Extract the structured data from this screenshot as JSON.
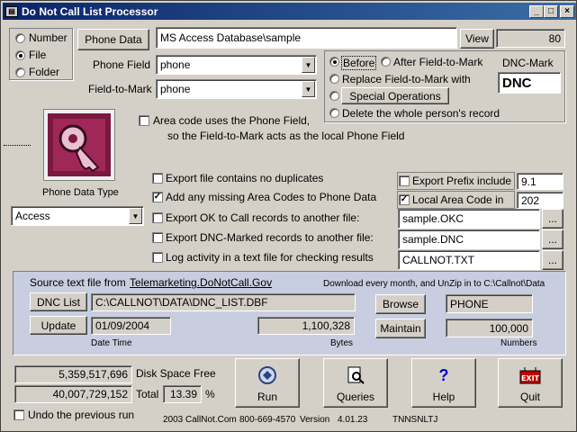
{
  "window": {
    "title": "Do Not Call List Processor",
    "min": "_",
    "max": "□",
    "close": "×"
  },
  "source_type": {
    "options": [
      "Number",
      "File",
      "Folder"
    ],
    "selected": "File"
  },
  "phone_data_button": "Phone Data",
  "phone_data_path": "MS Access Database\\sample",
  "view_button": "View",
  "count": "80",
  "phone_field": {
    "label": "Phone Field",
    "value": "phone"
  },
  "field_to_mark": {
    "label": "Field-to-Mark",
    "value": "phone"
  },
  "mark_position": {
    "before": "Before",
    "after": "After Field-to-Mark",
    "replace": "Replace Field-to-Mark with",
    "special_ops": "Special Operations",
    "delete": "Delete the whole person's record"
  },
  "dnc_mark": {
    "label": "DNC-Mark",
    "value": "DNC"
  },
  "area_code_note": {
    "line1": "Area code uses the Phone Field,",
    "line2": "so the Field-to-Mark acts as the local Phone Field"
  },
  "phone_data_type": {
    "label": "Phone Data Type",
    "value": "Access"
  },
  "options": {
    "no_duplicates": "Export file contains no duplicates",
    "add_area_codes": "Add any missing Area Codes to Phone Data",
    "export_ok": "Export OK to Call records to another file:",
    "export_dnc": "Export DNC-Marked records to another file:",
    "log_activity": "Log activity in a text file for checking results"
  },
  "export_prefix": {
    "label": "Export  Prefix include",
    "value": "9.1"
  },
  "local_area_code": {
    "label": "Local Area Code in",
    "value": "202"
  },
  "files": {
    "okc": "sample.OKC",
    "dnc": "sample.DNC",
    "log": "CALLNOT.TXT",
    "browse": "..."
  },
  "source_panel": {
    "prefix": "Source text file from",
    "site": "Telemarketing.DoNotCall.Gov",
    "download_note": "Download every month, and UnZip in to C:\\Callnot\\Data",
    "dnc_list_button": "DNC List",
    "dnc_list_path": "C:\\CALLNOT\\DATA\\DNC_LIST.DBF",
    "browse_button": "Browse",
    "field_name": "PHONE",
    "update_button": "Update",
    "date": "01/09/2004",
    "date_caption": "Date Time",
    "bytes": "1,100,328",
    "bytes_caption": "Bytes",
    "maintain_button": "Maintain",
    "numbers": "100,000",
    "numbers_caption": "Numbers"
  },
  "disk": {
    "free": "5,359,517,696",
    "free_label": "Disk Space Free",
    "total": "40,007,729,152",
    "total_label": "Total",
    "pct": "13.39",
    "pct_sign": "%"
  },
  "undo": "Undo the previous run",
  "actions": {
    "run": "Run",
    "queries": "Queries",
    "help": "Help",
    "quit": "Quit"
  },
  "footer": {
    "copyright": "2003 CallNot.Com",
    "phone": "800-669-4570",
    "version_label": "Version",
    "version": "4.01.23",
    "code": "TNNSNLTJ"
  }
}
